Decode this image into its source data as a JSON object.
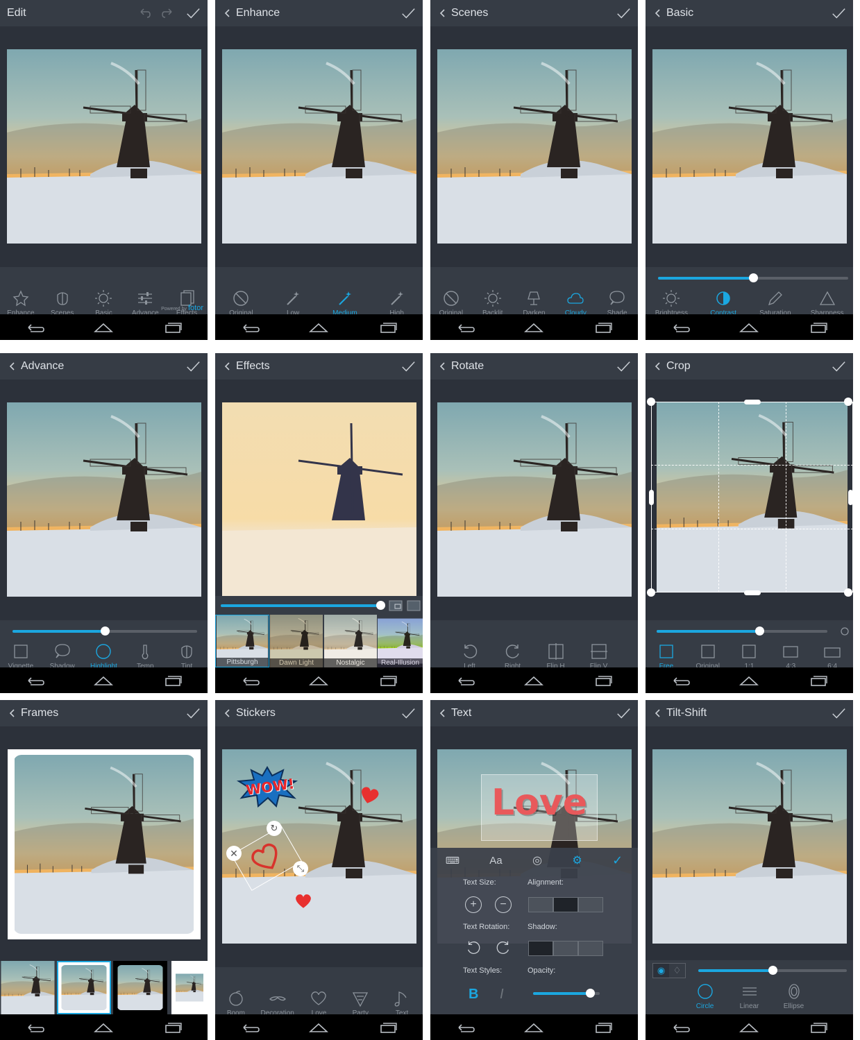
{
  "colors": {
    "accent": "#1ba7e0",
    "bar": "#363c45",
    "bg": "#2c313a"
  },
  "screens": {
    "edit": {
      "title": "Edit",
      "powered_by": "Powered by",
      "brand": "fotor",
      "tools": [
        "Enhance",
        "Scenes",
        "Basic",
        "Advance",
        "Effects"
      ]
    },
    "enhance": {
      "title": "Enhance",
      "tools": [
        "Original",
        "Low",
        "Medium",
        "High"
      ],
      "active": "Medium"
    },
    "scenes": {
      "title": "Scenes",
      "tools": [
        "Original",
        "Backlit",
        "Darken",
        "Cloudy",
        "Shade"
      ],
      "active": "Cloudy"
    },
    "basic": {
      "title": "Basic",
      "tools": [
        "Brightness",
        "Contrast",
        "Saturation",
        "Sharpness"
      ],
      "active": "Contrast",
      "slider_value": 0.5
    },
    "advance": {
      "title": "Advance",
      "tools": [
        "Vignette",
        "Shadow",
        "Highlight",
        "Temp",
        "Tint"
      ],
      "active": "Highlight",
      "slider_value": 0.5
    },
    "effects": {
      "title": "Effects",
      "filters": [
        "Pittsburgh",
        "Dawn Light",
        "Nostalgic",
        "Real-Illusion"
      ],
      "active": "Pittsburgh",
      "slider_value": 0.99
    },
    "rotate": {
      "title": "Rotate",
      "tools": [
        "Left",
        "Right",
        "Flip H",
        "Flip V"
      ]
    },
    "crop": {
      "title": "Crop",
      "tools": [
        "Free",
        "Original",
        "1:1",
        "4:3",
        "6:4"
      ],
      "active": "Free",
      "slider_value": 0.6
    },
    "frames": {
      "title": "Frames"
    },
    "stickers": {
      "title": "Stickers",
      "tools": [
        "Boom",
        "Decoration",
        "Love",
        "Party",
        "Text"
      ],
      "sticker_text": "WOW!"
    },
    "text": {
      "title": "Text",
      "overlay_text": "Love",
      "tabs": [
        "Aa"
      ],
      "labels": {
        "size": "Text Size:",
        "alignment": "Alignment:",
        "rotation": "Text Rotation:",
        "shadow": "Shadow:",
        "styles": "Text Styles:",
        "opacity": "Opacity:"
      },
      "bold": "B",
      "italic": "I",
      "opacity_value": 0.85
    },
    "tiltshift": {
      "title": "Tilt-Shift",
      "tools": [
        "Circle",
        "Linear",
        "Ellipse"
      ],
      "active": "Circle",
      "slider_value": 0.5
    }
  }
}
